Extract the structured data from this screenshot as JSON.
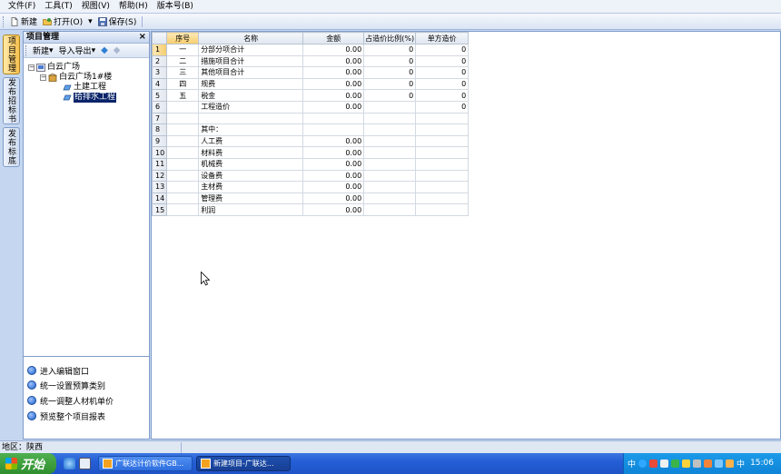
{
  "menubar": {
    "items": [
      "文件(F)",
      "工具(T)",
      "视图(V)",
      "帮助(H)",
      "版本号(B)"
    ]
  },
  "toolbar": {
    "new_label": "新建",
    "open_label": "打开(O)",
    "save_label": "保存(S)"
  },
  "side_tabs": [
    "项目管理",
    "发布招标书",
    "发布标底"
  ],
  "project_panel": {
    "title": "项目管理",
    "close_glyph": "×",
    "toolbar": {
      "new_label": "新建",
      "import_export_label": "导入导出"
    },
    "tree": {
      "root": "白云广场",
      "building": "白云广场1#楼",
      "children": [
        "土建工程",
        "给排水工程"
      ]
    },
    "actions": [
      "进入编辑窗口",
      "统一设置预算类别",
      "统一调整人材机单价",
      "预览整个项目报表"
    ]
  },
  "grid": {
    "columns": [
      "",
      "序号",
      "名称",
      "金额",
      "占造价比例(%)",
      "单方造价"
    ],
    "rows": [
      {
        "rn": "1",
        "seq": "一",
        "name": "分部分项合计",
        "amount": "0.00",
        "ratio": "0",
        "unit": "0"
      },
      {
        "rn": "2",
        "seq": "二",
        "name": "措施项目合计",
        "amount": "0.00",
        "ratio": "0",
        "unit": "0"
      },
      {
        "rn": "3",
        "seq": "三",
        "name": "其他项目合计",
        "amount": "0.00",
        "ratio": "0",
        "unit": "0"
      },
      {
        "rn": "4",
        "seq": "四",
        "name": "规费",
        "amount": "0.00",
        "ratio": "0",
        "unit": "0"
      },
      {
        "rn": "5",
        "seq": "五",
        "name": "税金",
        "amount": "0.00",
        "ratio": "0",
        "unit": "0"
      },
      {
        "rn": "6",
        "seq": "",
        "name": "工程造价",
        "amount": "0.00",
        "ratio": "",
        "unit": "0"
      },
      {
        "rn": "7",
        "seq": "",
        "name": "",
        "amount": "",
        "ratio": "",
        "unit": ""
      },
      {
        "rn": "8",
        "seq": "",
        "name": "其中：",
        "amount": "",
        "ratio": "",
        "unit": ""
      },
      {
        "rn": "9",
        "seq": "",
        "name": "人工费",
        "amount": "0.00",
        "ratio": "",
        "unit": ""
      },
      {
        "rn": "10",
        "seq": "",
        "name": "材料费",
        "amount": "0.00",
        "ratio": "",
        "unit": ""
      },
      {
        "rn": "11",
        "seq": "",
        "name": "机械费",
        "amount": "0.00",
        "ratio": "",
        "unit": ""
      },
      {
        "rn": "12",
        "seq": "",
        "name": "设备费",
        "amount": "0.00",
        "ratio": "",
        "unit": ""
      },
      {
        "rn": "13",
        "seq": "",
        "name": "主材费",
        "amount": "0.00",
        "ratio": "",
        "unit": ""
      },
      {
        "rn": "14",
        "seq": "",
        "name": "管理费",
        "amount": "0.00",
        "ratio": "",
        "unit": ""
      },
      {
        "rn": "15",
        "seq": "",
        "name": "利润",
        "amount": "0.00",
        "ratio": "",
        "unit": ""
      }
    ]
  },
  "statusbar": {
    "region": "地区：陕西"
  },
  "taskbar": {
    "start_label": "开始",
    "tasks": [
      "广联达计价软件GB...",
      "新建项目-广联达..."
    ],
    "ime_label": "中",
    "ime_label_2": "中",
    "clock": "15:06"
  },
  "colors": {
    "selection": "#0a246a",
    "header_highlight": "#f6cd6b",
    "taskbar_blue": "#245ed6",
    "start_green": "#2f8f2f"
  }
}
